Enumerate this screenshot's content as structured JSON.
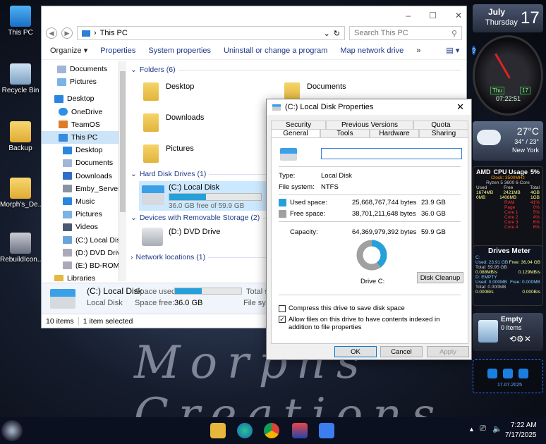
{
  "desktop": {
    "icons": [
      "This PC",
      "Recycle Bin",
      "Backup",
      "Morph's_De...",
      "RebuildIcon..."
    ],
    "watermark": "Morphs Creations"
  },
  "explorer": {
    "controls": {
      "min": "–",
      "max": "☐",
      "close": "✕"
    },
    "address": {
      "path": "This PC",
      "search_placeholder": "Search This PC"
    },
    "commands": [
      "Organize ▾",
      "Properties",
      "System properties",
      "Uninstall or change a program",
      "Map network drive",
      "»"
    ],
    "nav": [
      "Documents",
      "Pictures",
      "Desktop",
      "OneDrive",
      "TeamOS",
      "This PC",
      "Desktop",
      "Documents",
      "Downloads",
      "Emby_Server2.0",
      "Music",
      "Pictures",
      "Videos",
      "(C:) Local Disk",
      "(D:) DVD Drive",
      "(E:) BD-ROM D",
      "Libraries"
    ],
    "groups": {
      "folders": "Folders (6)",
      "drives": "Hard Disk Drives (1)",
      "removable": "Devices with Removable Storage (2)",
      "network": "Network locations (1)"
    },
    "folders": [
      "Desktop",
      "Documents",
      "Downloads",
      "Pictures"
    ],
    "drive": {
      "name": "(C:) Local Disk",
      "free": "36.0 GB free of 59.9 GB",
      "used_fraction": 0.4
    },
    "dvd": "(D:) DVD Drive",
    "details": {
      "name": "(C:) Local Disk",
      "type": "Local Disk",
      "used_label": "Space used:",
      "free_label": "Space free:",
      "free": "36.0 GB",
      "total_label": "Total s",
      "fs_label": "File syste"
    },
    "status": {
      "items": "10 items",
      "selected": "1 item selected"
    }
  },
  "dialog": {
    "title": "(C:) Local Disk Properties",
    "tabs_top": [
      "Security",
      "Previous Versions",
      "Quota"
    ],
    "tabs_bottom": [
      "General",
      "Tools",
      "Hardware",
      "Sharing"
    ],
    "type_label": "Type:",
    "type": "Local Disk",
    "fs_label": "File system:",
    "fs": "NTFS",
    "used_label": "Used space:",
    "used_bytes": "25,668,767,744 bytes",
    "used_gb": "23.9 GB",
    "free_label": "Free space:",
    "free_bytes": "38,701,211,648 bytes",
    "free_gb": "36.0 GB",
    "cap_label": "Capacity:",
    "cap_bytes": "64,369,979,392 bytes",
    "cap_gb": "59.9 GB",
    "drive_label": "Drive C:",
    "cleanup": "Disk Cleanup",
    "compress": "Compress this drive to save disk space",
    "index": "Allow files on this drive to have contents indexed in addition to file properties",
    "ok": "OK",
    "cancel": "Cancel",
    "apply": "Apply",
    "used_fraction": 0.399,
    "colors": {
      "used": "#26a0da",
      "free": "#a0a0a0"
    }
  },
  "gadgets": {
    "calendar": {
      "month": "July",
      "day": "Thursday",
      "date": "17"
    },
    "clock": {
      "time": "07:22:51",
      "day_label": "Thu",
      "date_label": "17"
    },
    "weather": {
      "temp": "27°C",
      "range": "34° / 23°",
      "city": "New York"
    },
    "cpu": {
      "title": "CPU Usage",
      "pct": "5%",
      "brand": "AMD",
      "clock": "Clock: 3500MHz",
      "model": "Ryzen 5 3600 6-Core",
      "hdr": [
        "Used",
        "Free",
        "Total"
      ],
      "vals": [
        "1674MB",
        "2421MB",
        "4GB"
      ],
      "vals2": [
        "0MB",
        "1408MB",
        "1GB"
      ],
      "rows": [
        [
          "RAM",
          "41%"
        ],
        [
          "Page",
          "0%"
        ],
        [
          "Core 1",
          "5%"
        ],
        [
          "Core 2",
          "4%"
        ],
        [
          "Core 3",
          "6%"
        ],
        [
          "Core 4",
          "6%"
        ]
      ]
    },
    "drives": {
      "title": "Drives Meter",
      "c": "C:",
      "c_used": "Used: 23.91 GB",
      "c_free": "Free: 36.04 GB",
      "c_total": "Total: 59.95 GB",
      "c_rw": "0.088MB/s",
      "c_rw2": "0.129MB/s",
      "d": "D: EMPTY",
      "d_used": "Used: 0.000MB",
      "d_free": "Free: 0.000MB",
      "d_total": "Total: 0.000MB",
      "d_rw": "0.000B/s",
      "d_rw2": "0.000B/s"
    },
    "recycle": {
      "title": "Empty",
      "items": "0 Items"
    },
    "security": {
      "date": "17.07.2025"
    }
  },
  "taskbar": {
    "time": "7:22 AM",
    "date": "7/17/2025"
  }
}
